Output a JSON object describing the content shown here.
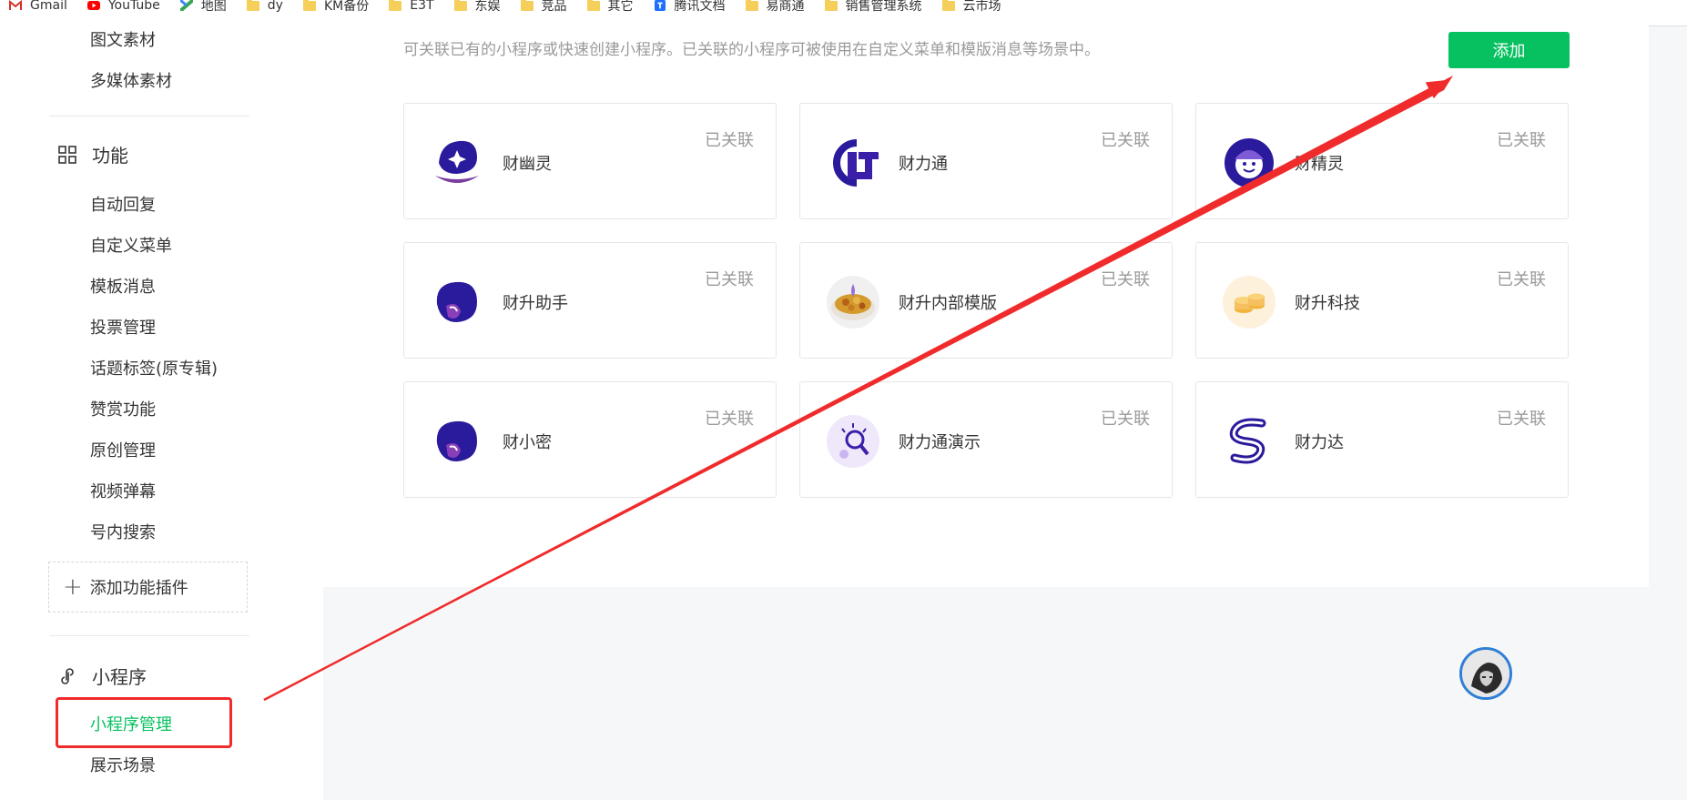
{
  "bookmarks": [
    {
      "label": "Gmail",
      "icon": "gmail-icon"
    },
    {
      "label": "YouTube",
      "icon": "youtube-icon"
    },
    {
      "label": "地图",
      "icon": "maps-icon"
    },
    {
      "label": "dy",
      "icon": "folder-icon"
    },
    {
      "label": "KM备份",
      "icon": "folder-icon"
    },
    {
      "label": "E3T",
      "icon": "folder-icon"
    },
    {
      "label": "东娱",
      "icon": "folder-icon"
    },
    {
      "label": "竞品",
      "icon": "folder-icon"
    },
    {
      "label": "其它",
      "icon": "folder-icon"
    },
    {
      "label": "腾讯文档",
      "icon": "tencent-docs-icon"
    },
    {
      "label": "易商通",
      "icon": "folder-icon"
    },
    {
      "label": "销售管理系统",
      "icon": "folder-icon"
    },
    {
      "label": "云市场",
      "icon": "folder-icon"
    }
  ],
  "sidebar": {
    "materials": [
      "图文素材",
      "多媒体素材"
    ],
    "features_title": "功能",
    "features": [
      "自动回复",
      "自定义菜单",
      "模板消息",
      "投票管理",
      "话题标签(原专辑)",
      "赞赏功能",
      "原创管理",
      "视频弹幕",
      "号内搜索"
    ],
    "add_plugin": "添加功能插件",
    "miniprogram_title": "小程序",
    "miniprogram_items": [
      "小程序管理",
      "展示场景"
    ]
  },
  "main": {
    "description": "可关联已有的小程序或快速创建小程序。已关联的小程序可被使用在自定义菜单和模版消息等场景中。",
    "add_button": "添加",
    "cards": [
      {
        "name": "财幽灵",
        "status": "已关联",
        "logo": "caiyouling-logo"
      },
      {
        "name": "财力通",
        "status": "已关联",
        "logo": "cailitong-logo"
      },
      {
        "name": "财精灵",
        "status": "已关联",
        "logo": "caijingling-logo"
      },
      {
        "name": "财升助手",
        "status": "已关联",
        "logo": "caisheng-zhushou-logo"
      },
      {
        "name": "财升内部模版",
        "status": "已关联",
        "logo": "caisheng-neibu-logo"
      },
      {
        "name": "财升科技",
        "status": "已关联",
        "logo": "caisheng-keji-logo"
      },
      {
        "name": "财小密",
        "status": "已关联",
        "logo": "caixiaomi-logo"
      },
      {
        "name": "财力通演示",
        "status": "已关联",
        "logo": "cailitong-yanshi-logo"
      },
      {
        "name": "财力达",
        "status": "已关联",
        "logo": "cailida-logo"
      }
    ]
  },
  "colors": {
    "accent": "#07c160",
    "annotation": "#f02b2b",
    "logo_purple": "#2a1a9c"
  }
}
